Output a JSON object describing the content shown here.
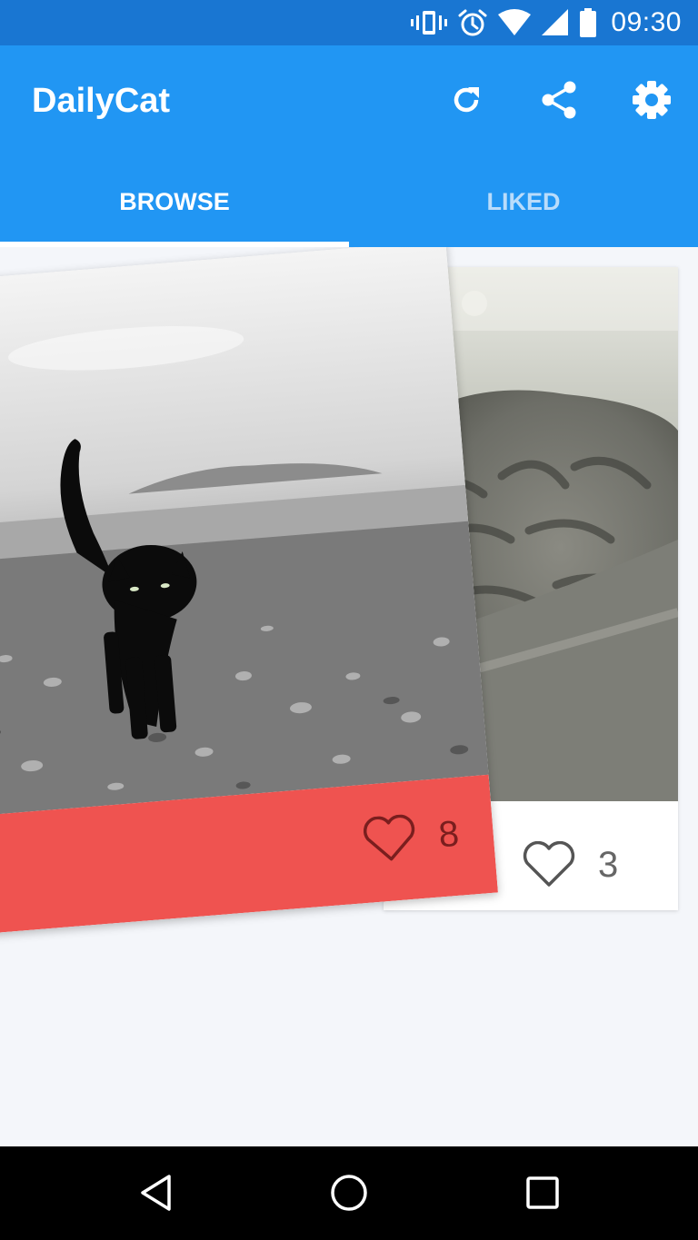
{
  "status_bar": {
    "time": "09:30",
    "icons": [
      "vibrate-icon",
      "alarm-icon",
      "wifi-icon",
      "signal-icon",
      "battery-icon"
    ]
  },
  "app_bar": {
    "title": "DailyCat",
    "actions": [
      "refresh-icon",
      "share-icon",
      "settings-icon"
    ],
    "color": "#2196f3"
  },
  "tabs": [
    {
      "label": "BROWSE",
      "active": true
    },
    {
      "label": "LIKED",
      "active": false
    }
  ],
  "cards": [
    {
      "likes": "8",
      "liked": true,
      "footer_color": "#ef5350",
      "photo": "black cat walking on pebble beach"
    },
    {
      "likes": "3",
      "liked": false,
      "footer_color": "#ffffff",
      "photo": "close-up of grey tabby cat fur"
    }
  ],
  "nav_bar": {
    "buttons": [
      "back-icon",
      "home-icon",
      "recents-icon"
    ]
  }
}
